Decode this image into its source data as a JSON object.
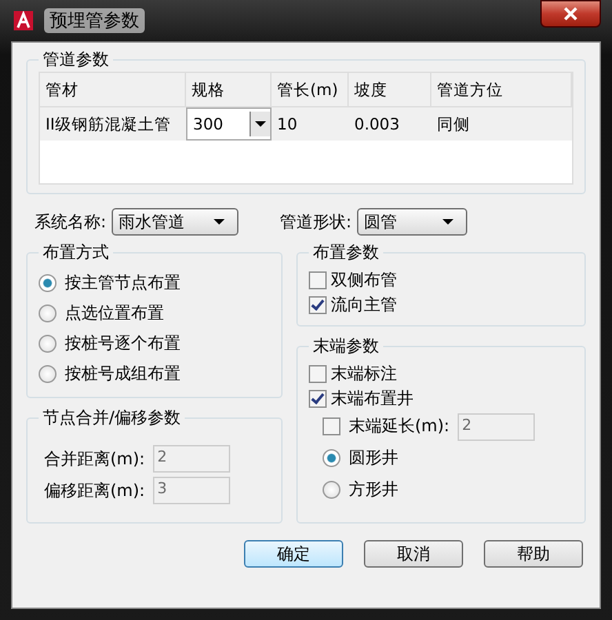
{
  "window": {
    "title": "预埋管参数"
  },
  "pipe_params": {
    "title": "管道参数",
    "columns": [
      "管材",
      "规格",
      "管长(m)",
      "坡度",
      "管道方位"
    ],
    "rows": [
      {
        "material": "II级钢筋混凝土管",
        "spec": "300",
        "length": "10",
        "slope": "0.003",
        "side": "同侧"
      }
    ]
  },
  "system_name": {
    "label": "系统名称:",
    "value": "雨水管道"
  },
  "pipe_shape": {
    "label": "管道形状:",
    "value": "圆管"
  },
  "layout_mode": {
    "title": "布置方式",
    "options": [
      {
        "label": "按主管节点布置",
        "selected": true
      },
      {
        "label": "点选位置布置",
        "selected": false
      },
      {
        "label": "按桩号逐个布置",
        "selected": false
      },
      {
        "label": "按桩号成组布置",
        "selected": false
      }
    ]
  },
  "node_merge": {
    "title": "节点合并/偏移参数",
    "fields": [
      {
        "label": "合并距离(m):",
        "value": "2",
        "disabled": true
      },
      {
        "label": "偏移距离(m):",
        "value": "3",
        "disabled": true
      }
    ]
  },
  "layout_params": {
    "title": "布置参数",
    "options": [
      {
        "label": "双侧布管",
        "checked": false
      },
      {
        "label": "流向主管",
        "checked": true
      }
    ]
  },
  "end_params": {
    "title": "末端参数",
    "checks": [
      {
        "label": "末端标注",
        "checked": false
      },
      {
        "label": "末端布置井",
        "checked": true
      }
    ],
    "extend": {
      "label": "末端延长(m):",
      "checked": false,
      "value": "2",
      "disabled": true
    },
    "shapes": [
      {
        "label": "圆形井",
        "selected": true
      },
      {
        "label": "方形井",
        "selected": false
      }
    ]
  },
  "buttons": [
    {
      "label": "确定",
      "default": true
    },
    {
      "label": "取消",
      "default": false
    },
    {
      "label": "帮助",
      "default": false
    }
  ]
}
